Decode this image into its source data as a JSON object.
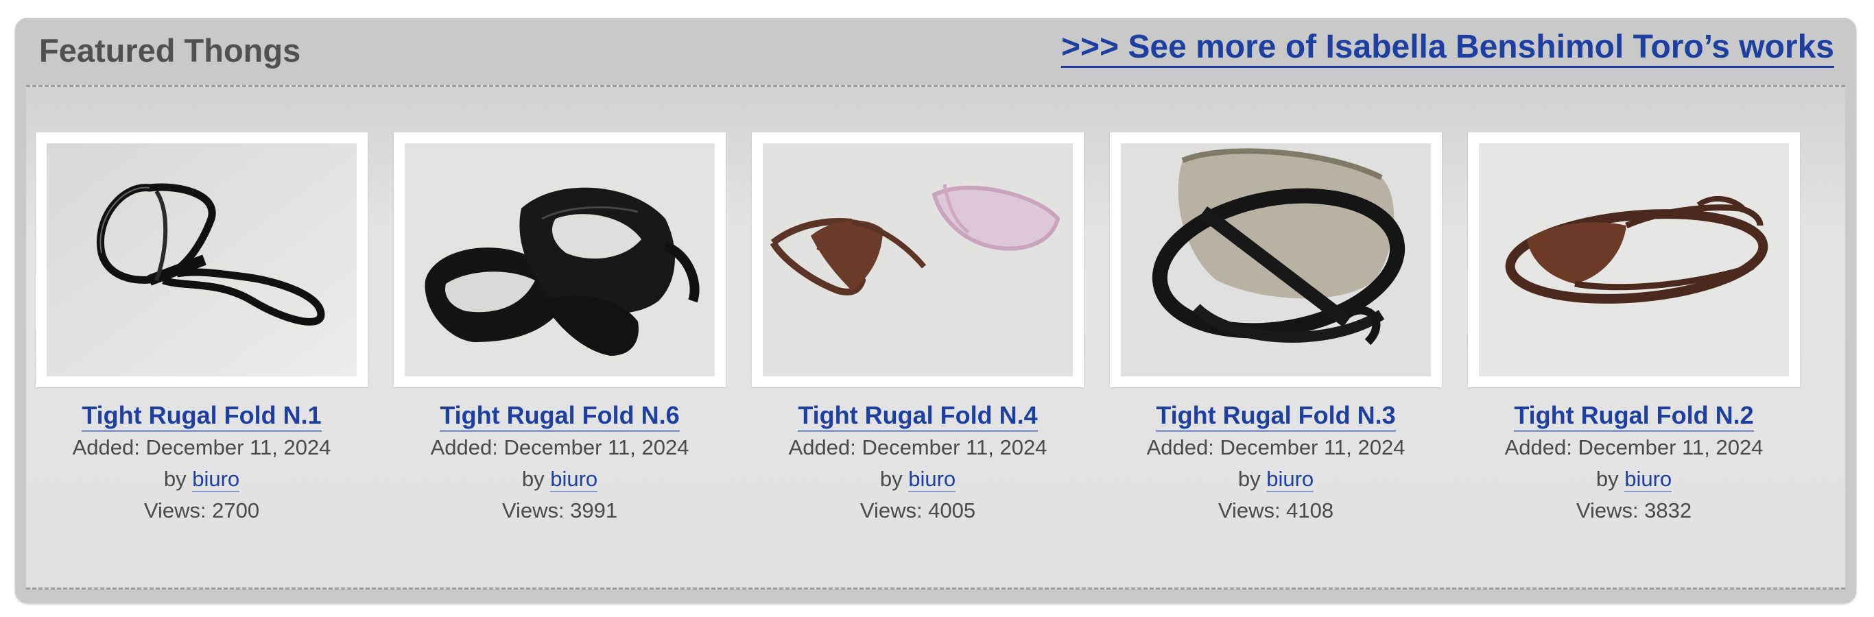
{
  "panel": {
    "title": "Featured Thongs",
    "more_link": ">>> See more of Isabella Benshimol Toro’s works"
  },
  "cards": [
    {
      "title": "Tight Rugal Fold N.1",
      "added": "Added: December 11, 2024",
      "by": "by",
      "author": "biuro",
      "views": "Views: 2700",
      "image": "black-latex-thong-photo"
    },
    {
      "title": "Tight Rugal Fold N.6",
      "added": "Added: December 11, 2024",
      "by": "by",
      "author": "biuro",
      "views": "Views: 3991",
      "image": "black-latex-thongs-pile-photo"
    },
    {
      "title": "Tight Rugal Fold N.4",
      "added": "Added: December 11, 2024",
      "by": "by",
      "author": "biuro",
      "views": "Views: 4005",
      "image": "brown-and-pink-thongs-photo"
    },
    {
      "title": "Tight Rugal Fold N.3",
      "added": "Added: December 11, 2024",
      "by": "by",
      "author": "biuro",
      "views": "Views: 4108",
      "image": "black-and-clear-thongs-photo"
    },
    {
      "title": "Tight Rugal Fold N.2",
      "added": "Added: December 11, 2024",
      "by": "by",
      "author": "biuro",
      "views": "Views: 3832",
      "image": "brown-thong-photo"
    }
  ],
  "colors": {
    "link": "#1e3ea0",
    "panel_bg": "#c9c9c9",
    "title_text": "#505050"
  }
}
